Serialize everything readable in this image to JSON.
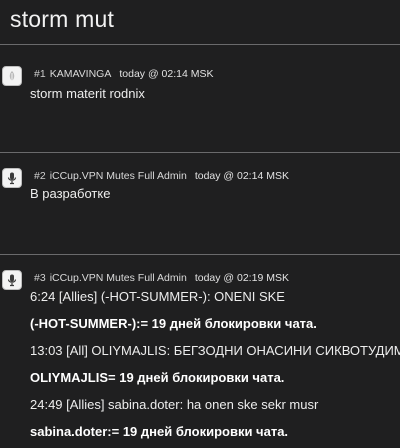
{
  "page": {
    "title": "storm mut"
  },
  "posts": [
    {
      "number": "#1",
      "author": "KAMAVINGA",
      "timestamp": "today @ 02:14 MSK",
      "avatar_icon": "leaf-icon",
      "lines": [
        "storm materit rodnix"
      ]
    },
    {
      "number": "#2",
      "author": "iCCup.VPN Mutes Full Admin",
      "timestamp": "today @ 02:14 MSK",
      "avatar_icon": "microphone-icon",
      "lines": [
        "В разработке"
      ]
    },
    {
      "number": "#3",
      "author": "iCCup.VPN Mutes Full Admin",
      "timestamp": "today @ 02:19 MSK",
      "avatar_icon": "microphone-icon",
      "lines": [
        "6:24 [Allies] (-HOT-SUMMER-): ONENI SKE",
        "(-HOT-SUMMER-):= 19 дней блокировки чата.",
        "13:03 [All] OLIYMAJLIS: БЕГЗОДНИ ОНАСИНИ СИКВОТУДИМ",
        "OLIYMAJLIS= 19 дней блокировки чата.",
        "24:49 [Allies] sabina.doter: ha onen ske sekr musr",
        "sabina.doter:= 19 дней блокировки чата."
      ]
    }
  ]
}
